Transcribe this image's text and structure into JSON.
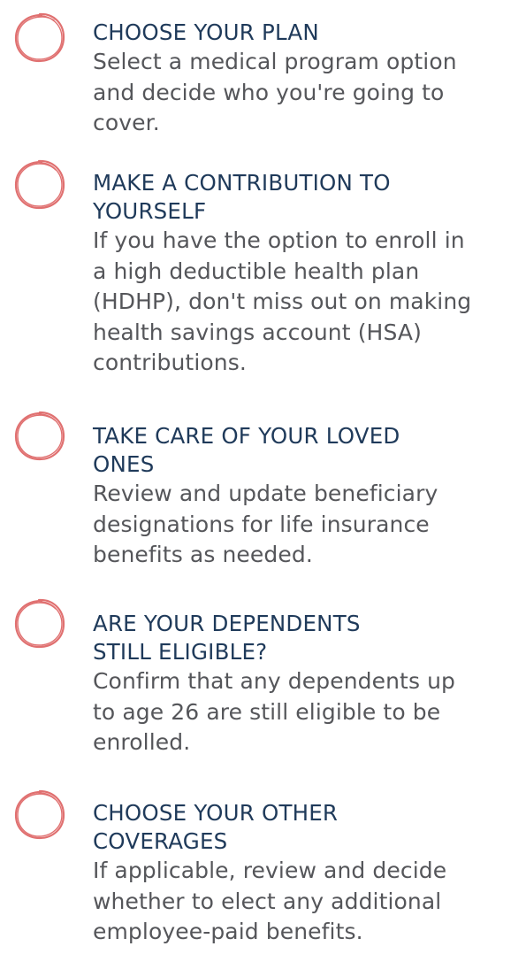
{
  "accent_color": "#e07070",
  "title_color": "#1f3a5a",
  "body_color": "#55565a",
  "items": [
    {
      "title_lines": [
        "CHOOSE YOUR PLAN"
      ],
      "desc_lines": [
        "Select a medical program option",
        "and decide who you're going to",
        "cover."
      ]
    },
    {
      "title_lines": [
        "MAKE A CONTRIBUTION TO",
        "YOURSELF"
      ],
      "desc_lines": [
        "If you have the option to enroll in",
        "a high deductible health plan",
        "(HDHP), don't miss out on making",
        "health savings account (HSA)",
        "contributions."
      ]
    },
    {
      "title_lines": [
        "TAKE CARE OF YOUR LOVED",
        "ONES"
      ],
      "desc_lines": [
        "Review and update beneficiary",
        "designations for life insurance",
        "benefits as needed."
      ]
    },
    {
      "title_lines": [
        "ARE YOUR DEPENDENTS",
        "STILL ELIGIBLE?"
      ],
      "desc_lines": [
        "Confirm that any dependents up",
        "to age 26 are still eligible to be",
        "enrolled."
      ]
    },
    {
      "title_lines": [
        "CHOOSE YOUR OTHER",
        "COVERAGES"
      ],
      "desc_lines": [
        "If applicable, review and decide",
        "whether to elect any additional",
        "employee-paid benefits."
      ]
    }
  ]
}
